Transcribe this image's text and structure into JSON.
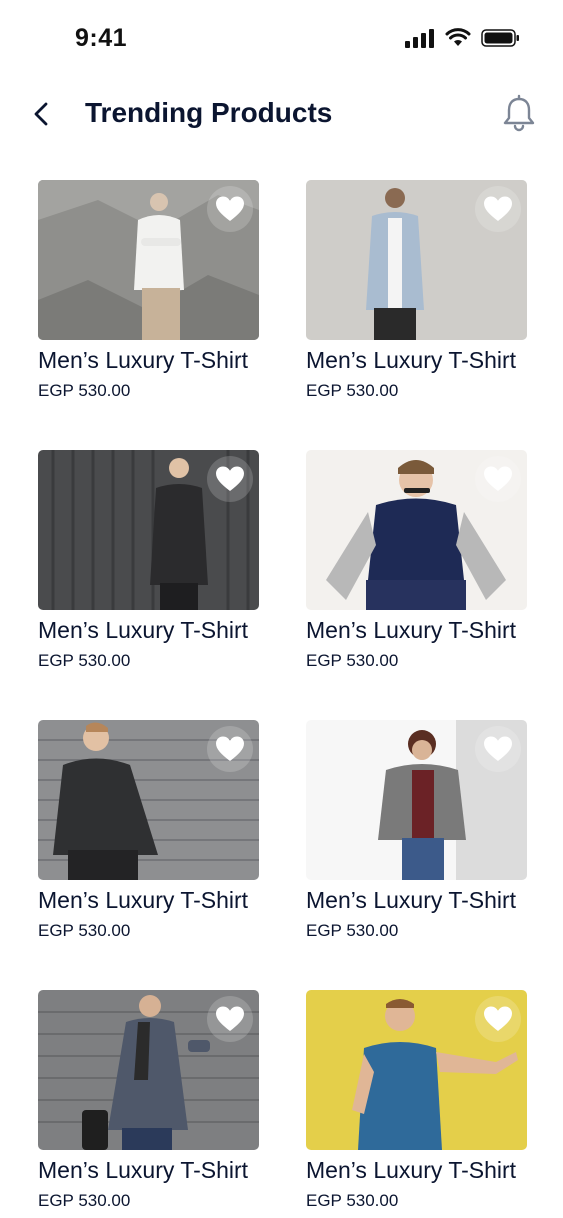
{
  "status_bar": {
    "time": "9:41"
  },
  "header": {
    "title": "Trending Products"
  },
  "accent_color": "#0b1530",
  "products": [
    {
      "name": "Men’s Luxury T-Shirt",
      "price": "EGP 530.00"
    },
    {
      "name": "Men’s Luxury T-Shirt",
      "price": "EGP 530.00"
    },
    {
      "name": "Men’s Luxury T-Shirt",
      "price": "EGP 530.00"
    },
    {
      "name": "Men’s Luxury T-Shirt",
      "price": "EGP 530.00"
    },
    {
      "name": "Men’s Luxury T-Shirt",
      "price": "EGP 530.00"
    },
    {
      "name": "Men’s Luxury T-Shirt",
      "price": "EGP 530.00"
    },
    {
      "name": "Men’s Luxury T-Shirt",
      "price": "EGP 530.00"
    },
    {
      "name": "Men’s Luxury T-Shirt",
      "price": "EGP 530.00"
    }
  ],
  "icons": [
    "signal-icon",
    "wifi-icon",
    "battery-icon",
    "back-arrow-icon",
    "bell-icon",
    "heart-icon"
  ]
}
